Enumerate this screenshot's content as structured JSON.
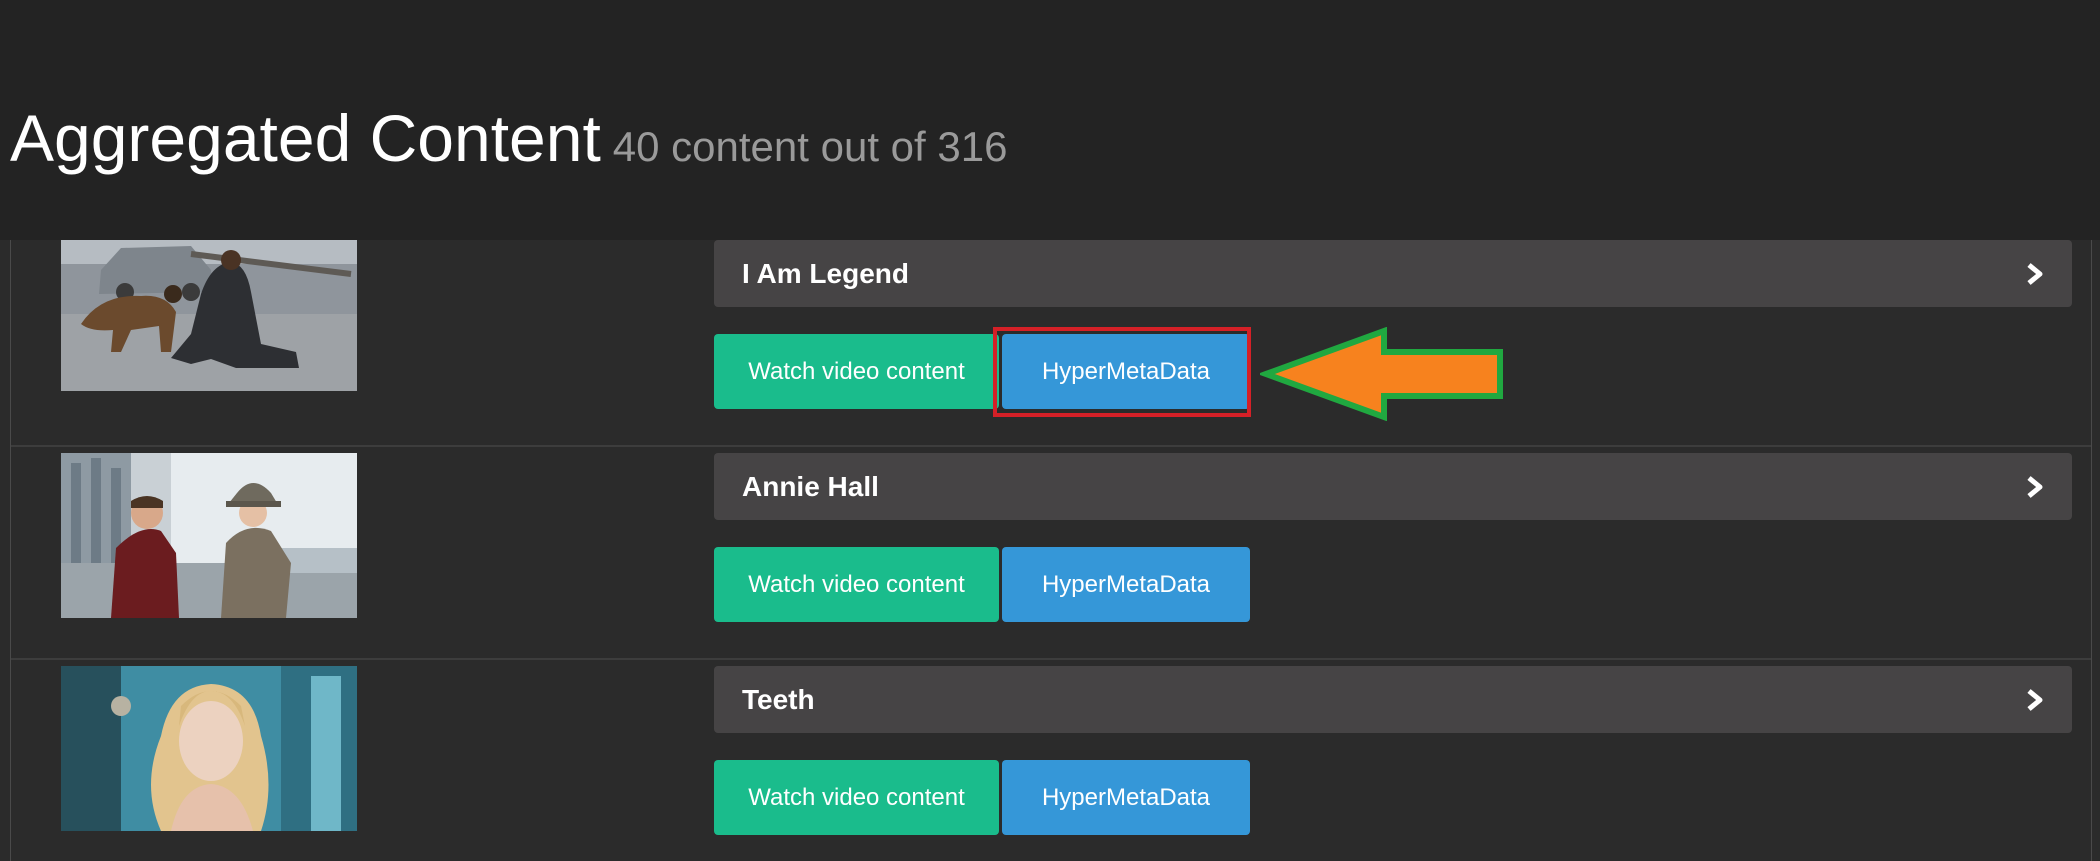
{
  "header": {
    "title": "Aggregated Content",
    "count_text": "40 content out of 316"
  },
  "items": [
    {
      "title": "I Am Legend",
      "watch_label": "Watch video content",
      "meta_label": "HyperMetaData",
      "thumb_icon": "movie-still-i-am-legend"
    },
    {
      "title": "Annie Hall",
      "watch_label": "Watch video content",
      "meta_label": "HyperMetaData",
      "thumb_icon": "movie-still-annie-hall"
    },
    {
      "title": "Teeth",
      "watch_label": "Watch video content",
      "meta_label": "HyperMetaData",
      "thumb_icon": "movie-still-teeth"
    }
  ],
  "colors": {
    "header_bg": "#232323",
    "page_bg": "#2b2b2b",
    "title_bar_bg": "#464445",
    "watch_button": "#1abc8c",
    "meta_button": "#3597d8",
    "highlight_border": "#d52027",
    "arrow_fill": "#f7821e",
    "arrow_stroke": "#20a840"
  },
  "annotations": {
    "arrow_icon": "pointing-arrow-icon",
    "highlight_target": "HyperMetaData"
  }
}
